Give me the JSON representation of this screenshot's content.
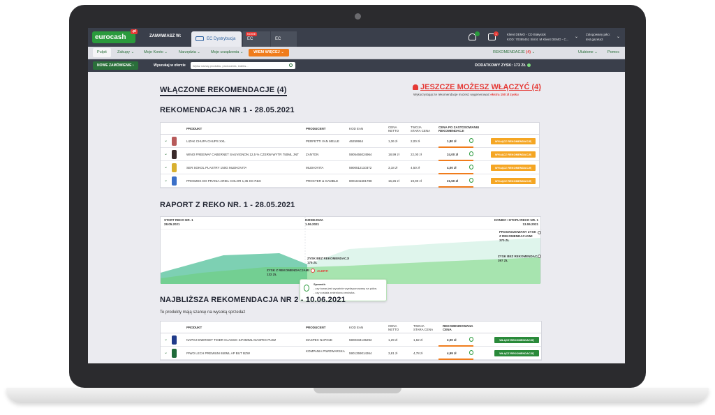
{
  "topbar": {
    "logo": "eurocash",
    "logo_pl": ".pl",
    "zamawiasz": "ZAMAWIASZ W:",
    "tabs": [
      {
        "label": "EC Dystrybucja",
        "badge": ""
      },
      {
        "label": "EC Market",
        "badge": "NOWE"
      },
      {
        "label": "EC Serwis",
        "badge": ""
      }
    ],
    "notif_badge": "",
    "msg_badge": "1",
    "client_line1": "Klient DEMO - CD Białystok",
    "client_line2": "KOD: 70385451 Skrót: M Klient DEMO - C...",
    "logged_line1": "Zalogowany jako:",
    "logged_line2": "test.gazeta3"
  },
  "nav": {
    "items": [
      "Pulpit",
      "Zakupy",
      "Moje Konto",
      "Narzędzia",
      "Moje urządzenia"
    ],
    "more": "WIEM WIĘCEJ",
    "reko_label": "REKOMENDACJE",
    "reko_count": "(4)",
    "ulubione": "Ulubione",
    "pomoc": "Pomoc"
  },
  "searchbar": {
    "new_order": "NOWE ZAMÓWIENIE",
    "search_label": "Wyszukaj w ofercie",
    "search_placeholder": "Wpisz nazwę produktu, producenta, indeks...",
    "zysk": "DODATKOWY ZYSK: 173 ZŁ"
  },
  "section1": {
    "title": "WŁĄCZONE REKOMENDACJE (4)",
    "promo": "JESZCZE MOŻESZ WŁĄCZYĆ (4)",
    "promo_sub": "Wykorzystując te rekomendacje możesz wygenerować",
    "promo_extra": "ekstra 150 zł zysku"
  },
  "reco1": {
    "title": "REKOMENDACJA NR 1 - 28.05.2021",
    "headers": [
      "PRODUKT",
      "PRODUCENT",
      "KOD EAN",
      "CENA NETTO",
      "TWOJA STARA CENA",
      "CENA PO ZASTOSOWANIU REKOMENDACJI"
    ],
    "rows": [
      {
        "produkt": "LIZAK CHUPA CHUPS XXL",
        "producent": "PERFETTI VAN MELLE",
        "ean": "46259964",
        "netto": "1,36 zł",
        "stara": "2,00 zł",
        "nowa": "1,80 zł",
        "action": "WYŁĄCZ REKOMENDACJĘ",
        "color": "#b75a5a"
      },
      {
        "produkt": "WINO FREEWAY CABERNET SAUVIGNON 12,5 % CZERW WYTR 750ML JNT",
        "producent": "ZANTON",
        "ean": "5905466024964",
        "netto": "18,99 zł",
        "stara": "22,00 zł",
        "nowa": "24,00 zł",
        "action": "WYŁĄCZ REKOMENDACJĘ",
        "color": "#3a2a2a"
      },
      {
        "produkt": "SER SOKOL PLASTRY 150G MLEKOVITA",
        "producent": "MLEKOVITA",
        "ean": "5900512110372",
        "netto": "3,18 zł",
        "stara": "4,50 zł",
        "nowa": "4,00 zł",
        "action": "WYŁĄCZ REKOMENDACJĘ",
        "color": "#d8b030"
      },
      {
        "produkt": "PROSZEK DO PRANIA ARIEL COLOR 1,35 KG P&G",
        "producent": "PROCTER & GAMBLE",
        "ean": "8001841681788",
        "netto": "16,26 zł",
        "stara": "19,90 zł",
        "nowa": "21,50 zł",
        "action": "WYŁĄCZ REKOMENDACJĘ",
        "color": "#3a6fc8"
      }
    ]
  },
  "report": {
    "title": "RAPORT Z REKO NR. 1 - 28.05.2021",
    "start_label": "START REKO NR. 1",
    "start_date": "28.05.2021",
    "today_label": "DZISIEJSZA",
    "today_date": "1.06.2021",
    "end_label": "KONIEC I ETAPU REKO NR. 1",
    "end_date": "13.06.2021",
    "forecast": "PROGNOZOWANY ZYSK Z REKOMENDACJAMI",
    "forecast_val": "370 ZŁ",
    "without_end": "ZYSK BEZ REKOMENDACJI",
    "without_end_val": "397 ZŁ",
    "without_mid": "ZYSK BEZ REKOMENDACJI",
    "without_mid_val": "175 ZŁ",
    "with_mid": "ZYSK Z REKOMENDACJAMI",
    "with_mid_val": "132 ZŁ",
    "alert": "ALERT!",
    "tip_title": "Sprawdź:",
    "tip_line1": "- czy towar jest wyraźnie wyeksponowany na półce,",
    "tip_line2": "- czy została zmieniona cenówka."
  },
  "reco2": {
    "title": "NAJBLIŻSZA REKOMENDACJA NR 2 - 10.06.2021",
    "subtitle": "Te produkty mają szansę na wysoką sprzedaż",
    "headers": [
      "PRODUKT",
      "PRODUCENT",
      "KOD EAN",
      "CENA NETTO",
      "TWOJA STARA CENA",
      "REKOMENDOWANA CENA"
    ],
    "rows": [
      {
        "produkt": "NAPOJ ENERGET TIGER CLASSIC 24*250ML MASPEX PUSZ",
        "producent": "MASPEX NAPOJE",
        "ean": "5900334135292",
        "netto": "1,29 zł",
        "stara": "1,62 zł",
        "nowa": "2,00 zł",
        "action": "WŁĄCZ REKOMENDACJĘ",
        "color": "#1f3a8a"
      },
      {
        "produkt": "PIWO LECH PREMIUM 650ML AP BUT BZW",
        "producent": "KOMPANIA PIWOWARSKA",
        "ean": "5901359014364",
        "netto": "3,81 zł",
        "stara": "4,78 zł",
        "nowa": "4,99 zł",
        "action": "WŁĄCZ REKOMENDACJĘ",
        "color": "#1f6a3a"
      }
    ]
  }
}
